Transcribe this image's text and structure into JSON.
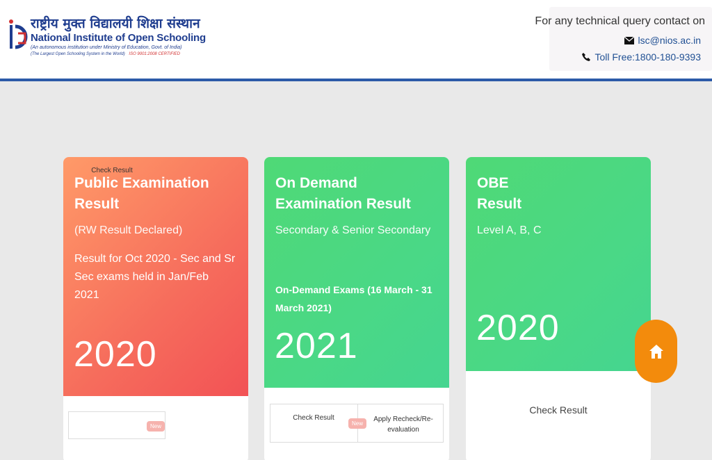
{
  "header": {
    "logo_hindi": "राष्ट्रीय मुक्त विद्यालयी शिक्षा संस्थान",
    "logo_english": "National Institute of Open Schooling",
    "logo_sub1": "(An autonomous institution under Ministry of Education, Govt. of India)",
    "logo_sub2": "(The Largest Open Schooling System in the World)",
    "logo_cert": "ISO 9001:2008 CERTIFIED",
    "contact_title": "For any technical query contact on",
    "email": "lsc@nios.ac.in",
    "phone": "Toll Free:1800-180-9393"
  },
  "cards": [
    {
      "title": "Public Examination Result",
      "subtitle": "(RW Result Declared)",
      "description": "Result for Oct 2020 - Sec and Sr Sec exams held in Jan/Feb 2021",
      "year": "2020",
      "buttons": [
        "Check Result"
      ],
      "badge": "New"
    },
    {
      "title": "On Demand Examination Result",
      "subtitle": "Secondary & Senior Secondary",
      "highlight": "On-Demand Exams (16 March - 31 March 2021)",
      "year": "2021",
      "buttons": [
        "Check Result",
        "Apply Recheck/Re-evaluation"
      ],
      "badge": "New"
    },
    {
      "title": "OBE Result",
      "subtitle": "Level A, B, C",
      "year": "2020",
      "buttons": [
        "Check Result"
      ]
    }
  ],
  "colors": {
    "brand_blue": "#2c5aa8",
    "card_red": "#f66c5c",
    "card_green": "#4ad886",
    "fab_orange": "#f38b0c"
  },
  "icons": [
    "envelope-icon",
    "phone-icon",
    "home-icon"
  ]
}
